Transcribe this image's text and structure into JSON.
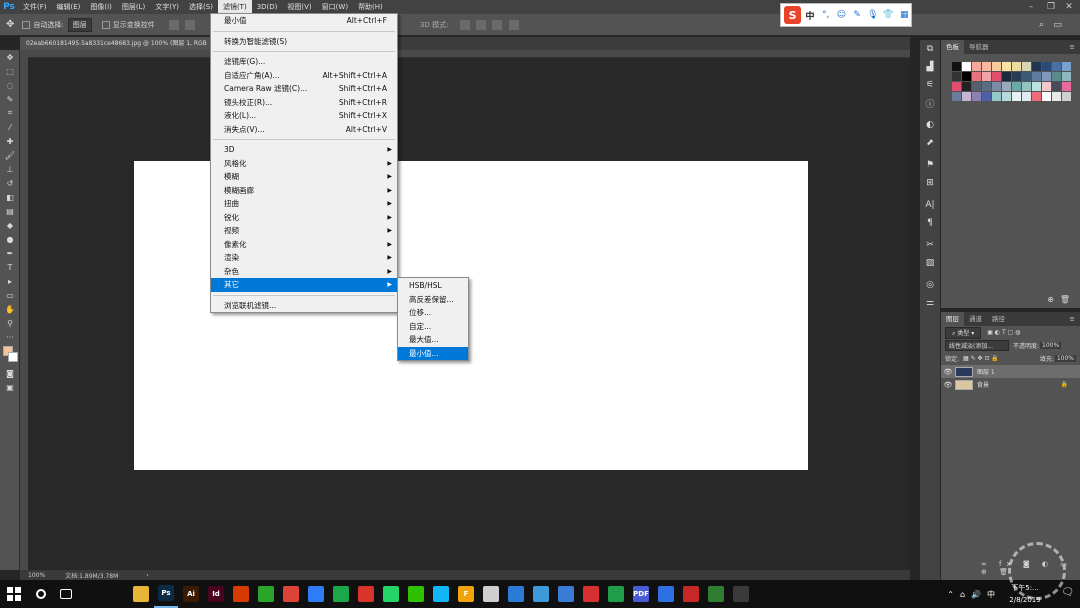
{
  "app": {
    "logo": "Ps"
  },
  "menubar": {
    "items": [
      "文件(F)",
      "编辑(E)",
      "图像(I)",
      "图层(L)",
      "文字(Y)",
      "选择(S)",
      "滤镜(T)",
      "3D(D)",
      "视图(V)",
      "窗口(W)",
      "帮助(H)"
    ],
    "active_index": 6
  },
  "options_bar": {
    "auto_select_label": "自动选择:",
    "auto_select_value": "图层",
    "show_transform_label": "显示变换控件",
    "mode_3d_label": "3D 模式:"
  },
  "document": {
    "tab_title": "02eab660181495.5a8331ce48683.jpg @ 100% (图层 1, RGB",
    "zoom": "100%",
    "doc_info": "文档:1.89M/3.78M"
  },
  "filter_menu": {
    "groups": [
      [
        {
          "label": "最小值",
          "shortcut": "Alt+Ctrl+F"
        }
      ],
      [
        {
          "label": "转换为智能滤镜(S)",
          "shortcut": ""
        }
      ],
      [
        {
          "label": "滤镜库(G)...",
          "shortcut": ""
        },
        {
          "label": "自适应广角(A)...",
          "shortcut": "Alt+Shift+Ctrl+A"
        },
        {
          "label": "Camera Raw 滤镜(C)...",
          "shortcut": "Shift+Ctrl+A"
        },
        {
          "label": "镜头校正(R)...",
          "shortcut": "Shift+Ctrl+R"
        },
        {
          "label": "液化(L)...",
          "shortcut": "Shift+Ctrl+X"
        },
        {
          "label": "消失点(V)...",
          "shortcut": "Alt+Ctrl+V"
        }
      ],
      [
        {
          "label": "3D",
          "submenu": true
        },
        {
          "label": "风格化",
          "submenu": true
        },
        {
          "label": "模糊",
          "submenu": true
        },
        {
          "label": "模糊画廊",
          "submenu": true
        },
        {
          "label": "扭曲",
          "submenu": true
        },
        {
          "label": "锐化",
          "submenu": true
        },
        {
          "label": "视频",
          "submenu": true
        },
        {
          "label": "像素化",
          "submenu": true
        },
        {
          "label": "渲染",
          "submenu": true
        },
        {
          "label": "杂色",
          "submenu": true
        },
        {
          "label": "其它",
          "submenu": true,
          "highlighted": true
        }
      ],
      [
        {
          "label": "浏览联机滤镜...",
          "shortcut": ""
        }
      ]
    ]
  },
  "other_submenu": {
    "items": [
      "HSB/HSL",
      "高反差保留...",
      "位移...",
      "自定...",
      "最大值...",
      "最小值..."
    ],
    "highlighted_index": 5
  },
  "swatches_panel": {
    "tabs": [
      "色板",
      "导航器"
    ],
    "colors": [
      "#111111",
      "#ffffff",
      "#f6a99a",
      "#f6b9a0",
      "#f9c9a0",
      "#fbe1a2",
      "#ecdca2",
      "#d6d6b5",
      "#1f3553",
      "#2b4a78",
      "#4a6fa3",
      "#7aa0cc",
      "#333333",
      "#000000",
      "#e8737e",
      "#f0a3a8",
      "#e0506a",
      "#1c2b3f",
      "#2a3c55",
      "#3e5878",
      "#5f7b9f",
      "#7f98ba",
      "#5a8a8a",
      "#8fb8c0",
      "#e04f6f",
      "#222222",
      "#555f6d",
      "#5a6d85",
      "#7a8da5",
      "#9aa9bd",
      "#6aa9a8",
      "#94c3c4",
      "#bde0e0",
      "#f3c6c8",
      "#4a4a5a",
      "#e86a9a",
      "#6b7b9a",
      "#c6b4d4",
      "#8d7fb1",
      "#4f5fa8",
      "#92c9c9",
      "#b8d9d9",
      "#e5f0f0",
      "#e0e8f0",
      "#ef6b7c",
      "#ffffff",
      "#e8e8e8",
      "#d0d0d0"
    ]
  },
  "layers_panel": {
    "tabs": [
      "图层",
      "通道",
      "路径"
    ],
    "filter_kind": "类型",
    "blend_mode": "线性减淡(添加...",
    "opacity_label": "不透明度:",
    "opacity_value": "100%",
    "lock_label": "锁定:",
    "fill_label": "填充:",
    "fill_value": "100%",
    "layers": [
      {
        "name": "图层 1",
        "selected": true
      },
      {
        "name": "背景",
        "selected": false,
        "locked": true
      }
    ]
  },
  "ime_bar": {
    "logo": "S",
    "mode": "中"
  },
  "taskbar": {
    "apps": [
      {
        "name": "search",
        "label": "",
        "color": "#101010",
        "open": false
      },
      {
        "name": "task-view",
        "label": "",
        "color": "#101010",
        "open": false
      },
      {
        "name": "pinwheel",
        "label": "",
        "color": "#101010",
        "open": false
      },
      {
        "name": "cortana",
        "label": "",
        "color": "#101010",
        "open": false
      },
      {
        "name": "file-explorer",
        "label": "",
        "color": "#e6b634",
        "open": false
      },
      {
        "name": "photoshop",
        "label": "Ps",
        "color": "#0b2a44",
        "open": true
      },
      {
        "name": "illustrator",
        "label": "Ai",
        "color": "#3a1a00",
        "open": false
      },
      {
        "name": "indesign",
        "label": "Id",
        "color": "#49021f",
        "open": false
      },
      {
        "name": "mug",
        "label": "",
        "color": "#d83b01",
        "open": false
      },
      {
        "name": "browser-360",
        "label": "",
        "color": "#2aa52a",
        "open": false
      },
      {
        "name": "chrome",
        "label": "",
        "color": "#db4437",
        "open": false
      },
      {
        "name": "baidu-netdisk",
        "label": "",
        "color": "#2f7df6",
        "open": false
      },
      {
        "name": "play",
        "label": "",
        "color": "#1aa84a",
        "open": false
      },
      {
        "name": "wps",
        "label": "",
        "color": "#d9342b",
        "open": false
      },
      {
        "name": "whatsapp",
        "label": "",
        "color": "#25d366",
        "open": false
      },
      {
        "name": "wechat",
        "label": "",
        "color": "#2dc100",
        "open": false
      },
      {
        "name": "qq",
        "label": "",
        "color": "#12b7f5",
        "open": false
      },
      {
        "name": "f-app",
        "label": "F",
        "color": "#f0a30a",
        "open": false
      },
      {
        "name": "bird",
        "label": "",
        "color": "#cfcfcf",
        "open": false
      },
      {
        "name": "blue-app",
        "label": "",
        "color": "#2b7bd6",
        "open": false
      },
      {
        "name": "globe",
        "label": "",
        "color": "#3c9ad8",
        "open": false
      },
      {
        "name": "send",
        "label": "",
        "color": "#3a7bd5",
        "open": false
      },
      {
        "name": "red-app",
        "label": "",
        "color": "#d63031",
        "open": false
      },
      {
        "name": "green-app",
        "label": "",
        "color": "#1e9e4a",
        "open": false
      },
      {
        "name": "pdf",
        "label": "PDF",
        "color": "#4a5bd6",
        "open": false
      },
      {
        "name": "baidu",
        "label": "",
        "color": "#2f6fe4",
        "open": false
      },
      {
        "name": "red-app-2",
        "label": "",
        "color": "#c62828",
        "open": false
      },
      {
        "name": "battery-app",
        "label": "",
        "color": "#2e7d32",
        "open": false
      },
      {
        "name": "calendar",
        "label": "",
        "color": "#3a3a3a",
        "open": false
      }
    ],
    "tray_ime": "中",
    "time": "下午5:...",
    "date": "2/8/2019"
  }
}
